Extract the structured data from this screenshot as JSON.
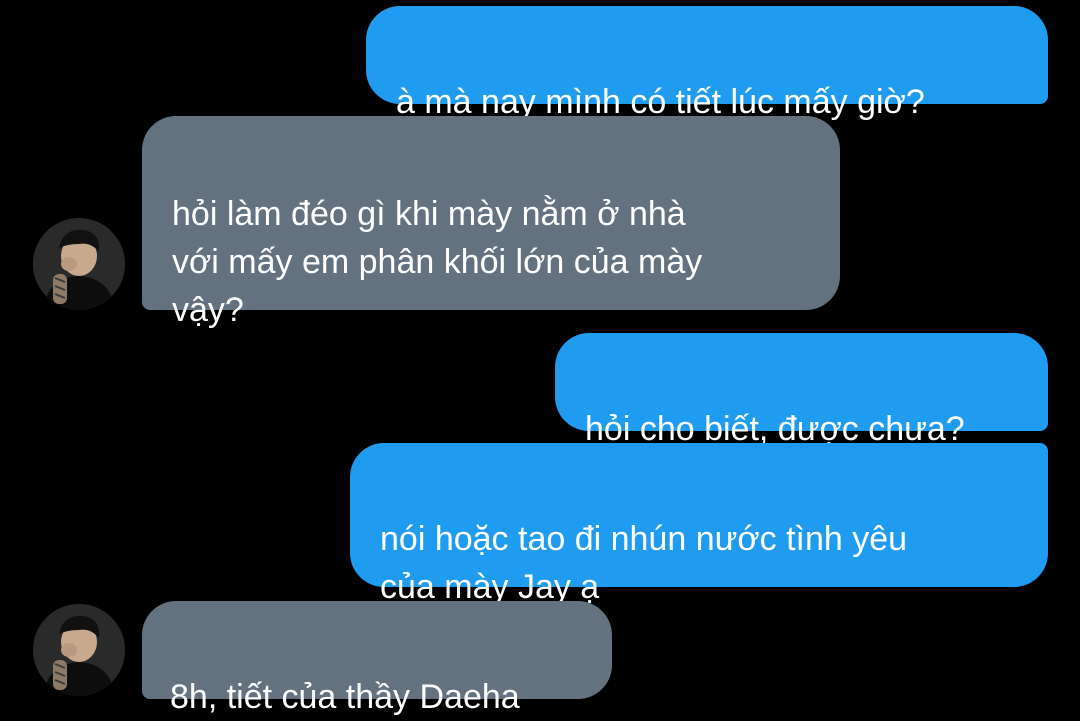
{
  "conversation": {
    "messages": [
      {
        "direction": "outgoing",
        "text": "à mà nay mình có tiết lúc mấy giờ?"
      },
      {
        "direction": "incoming",
        "text": "hỏi làm đéo gì khi mày nằm ở nhà\nvới mấy em phân khối lớn của mày\nvậy?"
      },
      {
        "direction": "outgoing",
        "text": "hỏi cho biết, được chưa?"
      },
      {
        "direction": "outgoing",
        "text": "nói hoặc tao đi nhún nước tình yêu\ncủa mày Jay ạ"
      },
      {
        "direction": "incoming",
        "text": "8h, tiết của thầy Daeha"
      }
    ]
  },
  "colors": {
    "background": "#000000",
    "outgoing_bubble": "#1f9bf0",
    "incoming_bubble": "#64727f",
    "text": "#ffffff"
  },
  "icons": {
    "contact_avatar": "avatar-photo-icon"
  }
}
